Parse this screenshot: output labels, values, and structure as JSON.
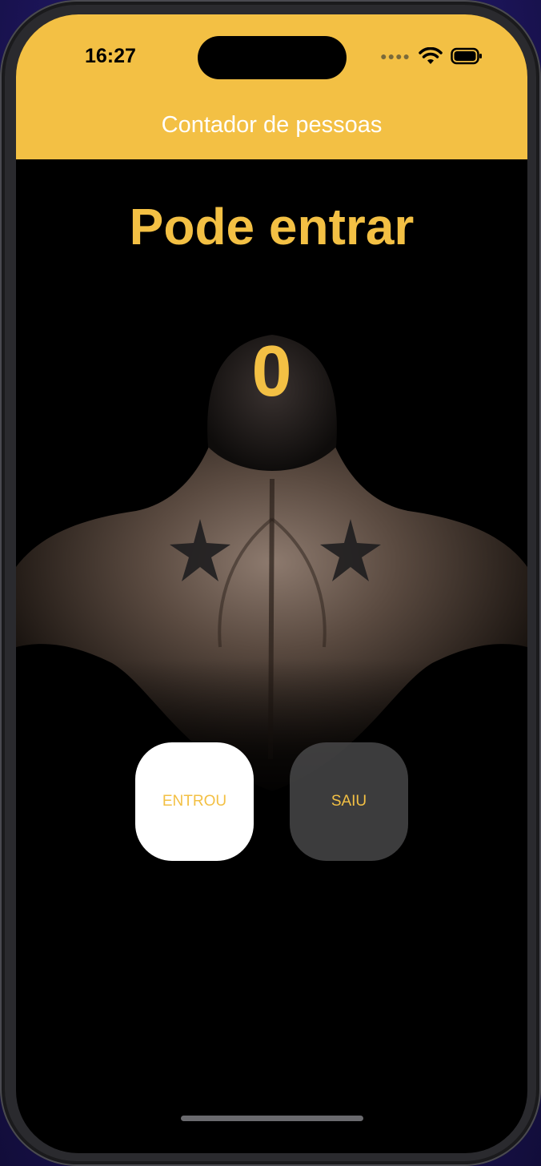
{
  "status_bar": {
    "time": "16:27",
    "signal_icon": "signal-dots-icon",
    "wifi_icon": "wifi-icon",
    "battery_icon": "battery-icon"
  },
  "nav": {
    "title": "Contador de pessoas"
  },
  "main": {
    "headline": "Pode entrar",
    "count": "0",
    "background_image": "athlete-back-photo"
  },
  "buttons": {
    "entered_label": "ENTROU",
    "left_label": "SAIU"
  },
  "colors": {
    "accent": "#f3c044",
    "background": "#000000",
    "entered_button": "#ffffff",
    "left_button": "#505052"
  }
}
